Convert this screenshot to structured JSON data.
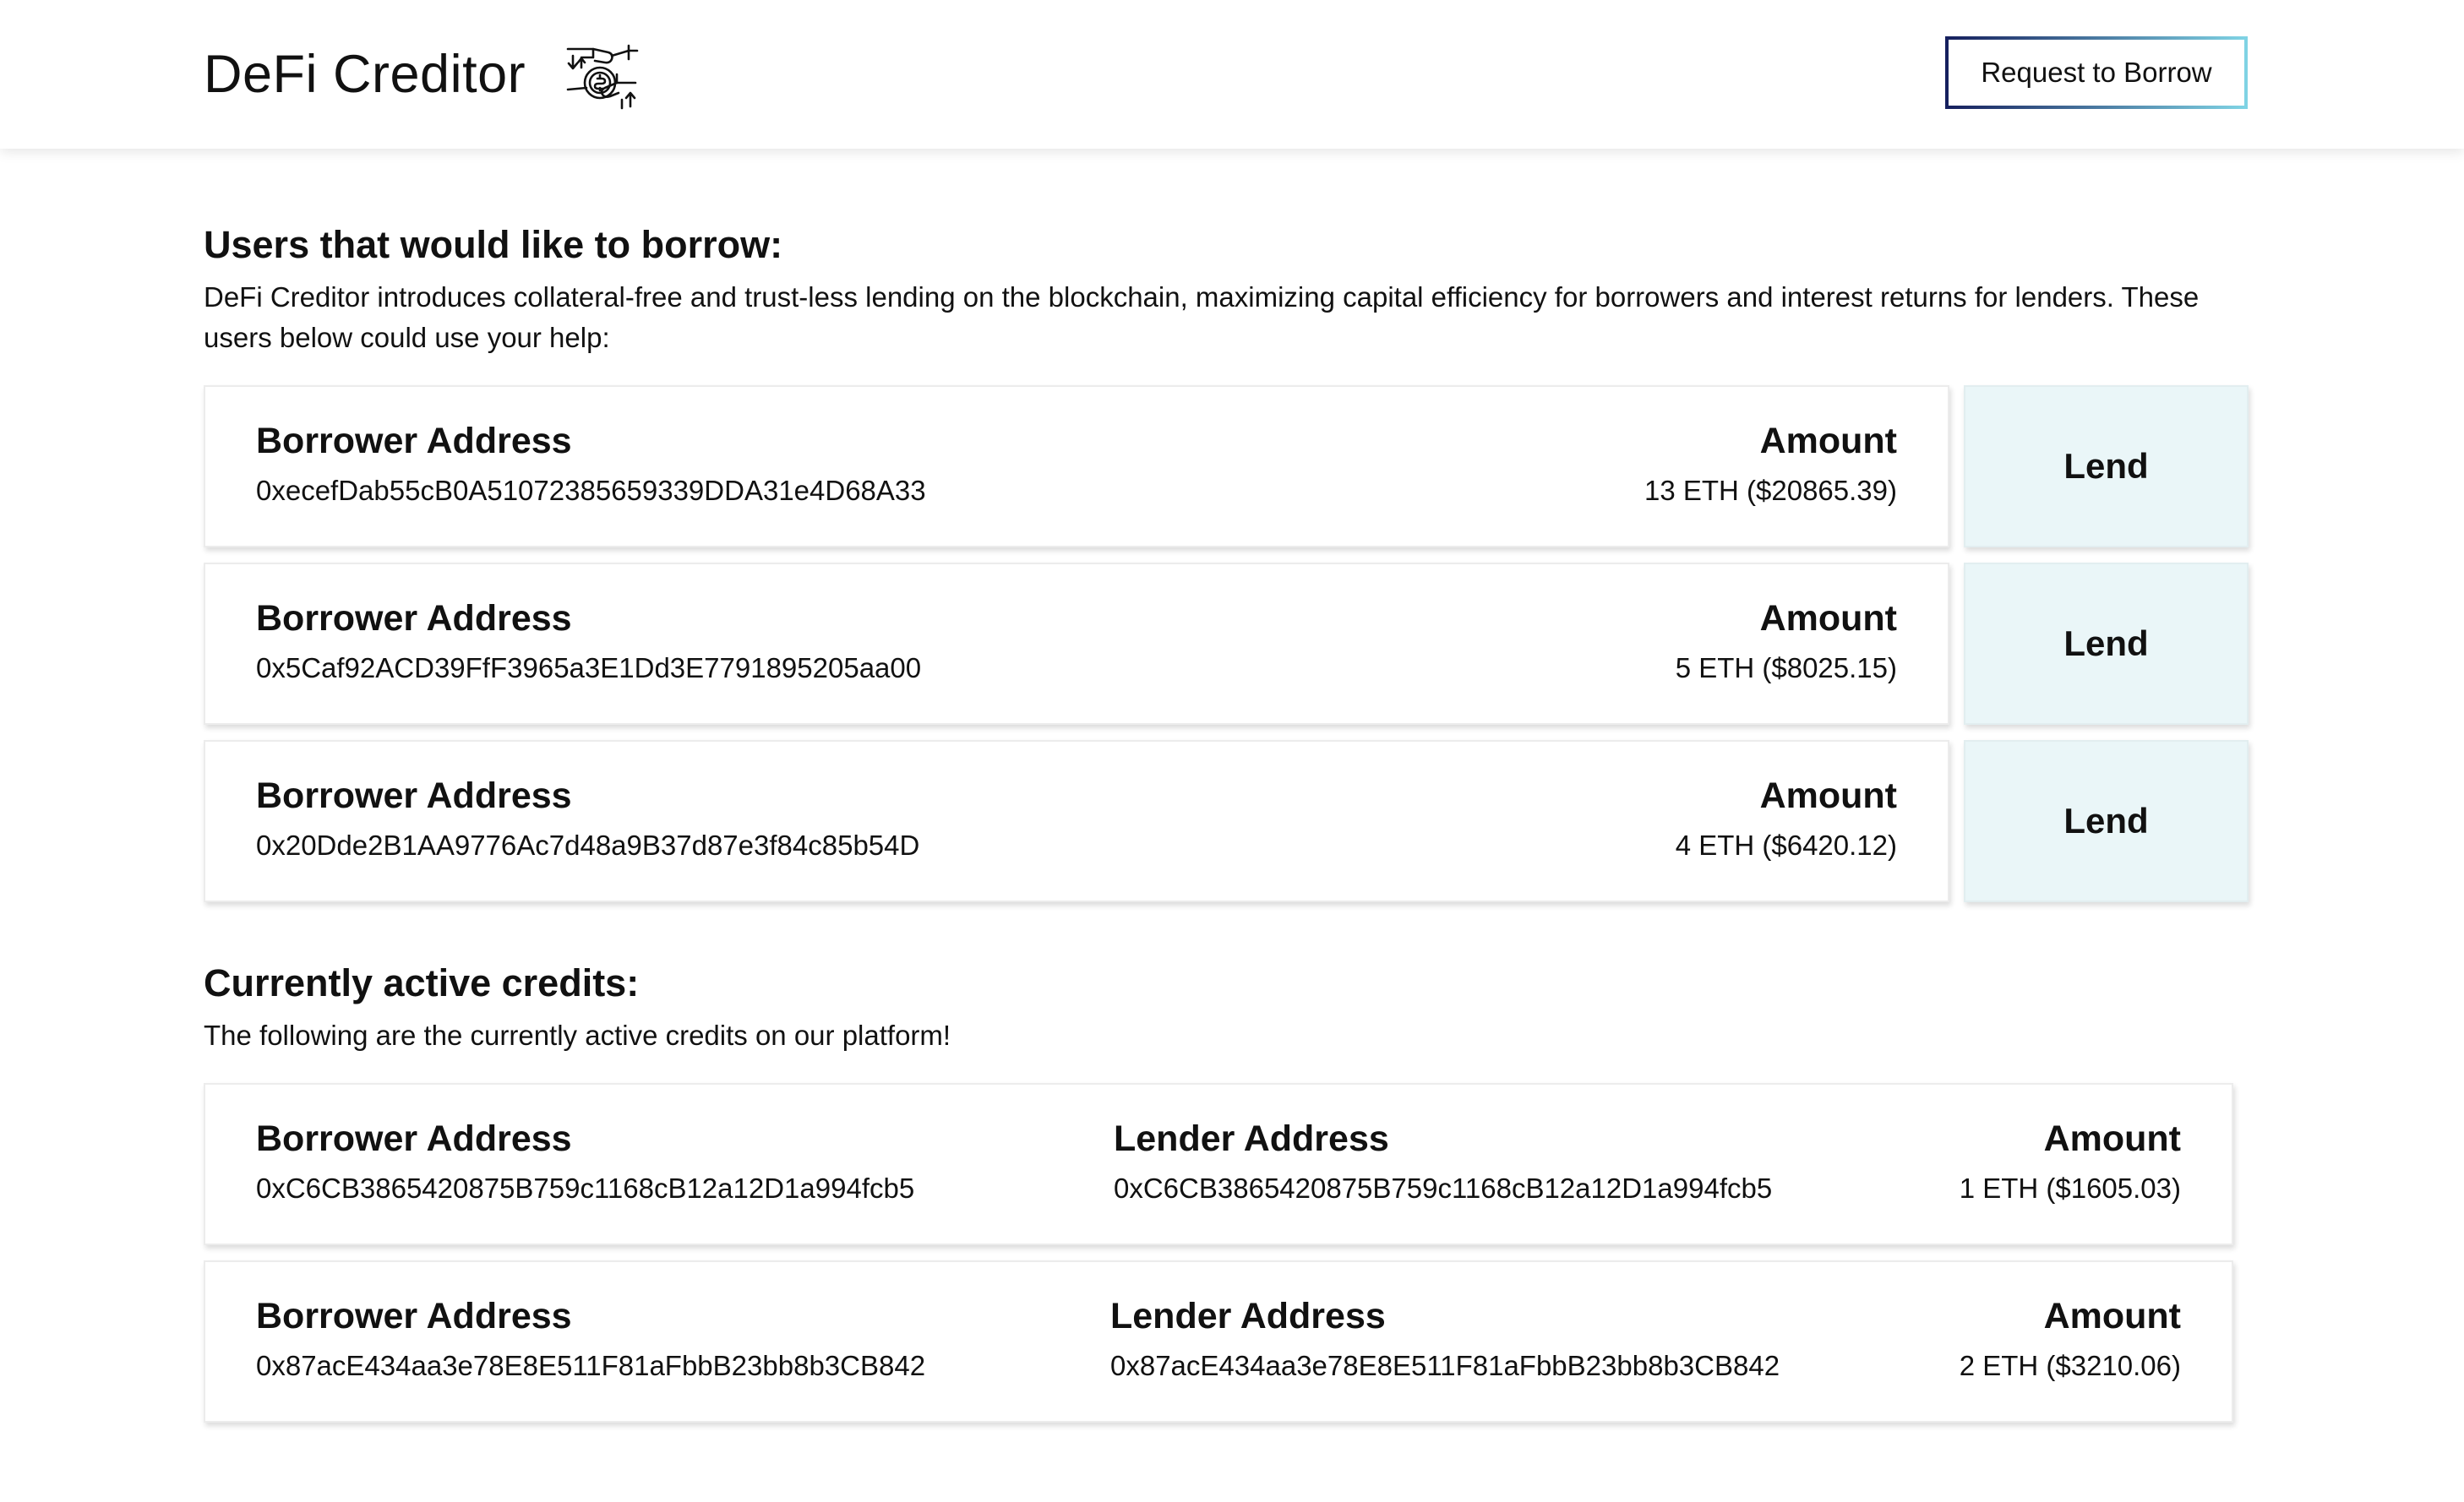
{
  "header": {
    "title": "DeFi Creditor",
    "logo_icon": "hands-exchange-coin-icon",
    "request_button_label": "Request to Borrow"
  },
  "borrow_section": {
    "title": "Users that would like to borrow:",
    "description": "DeFi Creditor introduces collateral-free and trust-less lending on the blockchain, maximizing capital efficiency for borrowers and interest returns for lenders. These users below could use your help:",
    "borrower_label": "Borrower Address",
    "amount_label": "Amount",
    "lend_label": "Lend",
    "requests": [
      {
        "borrower": "0xecefDab55cB0A51072385659339DDA31e4D68A33",
        "amount": "13 ETH ($20865.39)"
      },
      {
        "borrower": "0x5Caf92ACD39FfF3965a3E1Dd3E7791895205aa00",
        "amount": "5 ETH ($8025.15)"
      },
      {
        "borrower": "0x20Dde2B1AA9776Ac7d48a9B37d87e3f84c85b54D",
        "amount": "4 ETH ($6420.12)"
      }
    ]
  },
  "credits_section": {
    "title": "Currently active credits:",
    "description": "The following are the currently active credits on our platform!",
    "borrower_label": "Borrower Address",
    "lender_label": "Lender Address",
    "amount_label": "Amount",
    "credits": [
      {
        "borrower": "0xC6CB3865420875B759c1168cB12a12D1a994fcb5",
        "lender": "0xC6CB3865420875B759c1168cB12a12D1a994fcb5",
        "amount": "1 ETH ($1605.03)"
      },
      {
        "borrower": "0x87acE434aa3e78E8E511F81aFbbB23bb8b3CB842",
        "lender": "0x87acE434aa3e78E8E511F81aFbbB23bb8b3CB842",
        "amount": "2 ETH ($3210.06)"
      }
    ]
  },
  "colors": {
    "lend_button_bg": "#eaf6f8",
    "button_border_start": "#16205e",
    "button_border_end": "#7fd3e4"
  }
}
